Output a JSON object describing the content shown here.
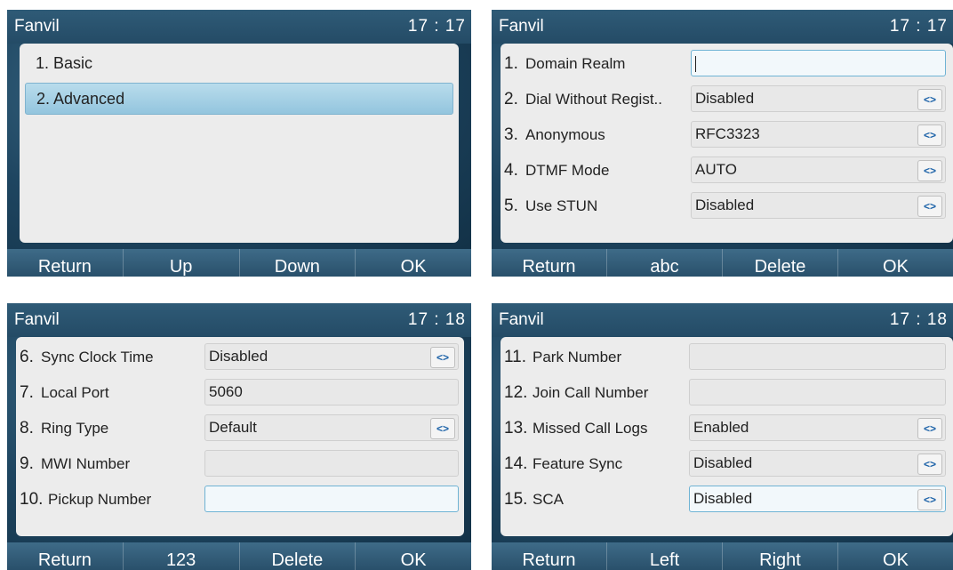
{
  "screens": [
    {
      "brand": "Fanvil",
      "time": "17 : 17",
      "menu": [
        "1. Basic",
        "2. Advanced"
      ],
      "selected_index": 1,
      "softkeys": [
        "Return",
        "Up",
        "Down",
        "OK"
      ]
    },
    {
      "brand": "Fanvil",
      "time": "17 : 17",
      "rows": [
        {
          "num": "1.",
          "label": "Domain Realm",
          "value": "",
          "selector": false,
          "focused": true
        },
        {
          "num": "2.",
          "label": "Dial Without Regist..",
          "value": "Disabled",
          "selector": true,
          "focused": false
        },
        {
          "num": "3.",
          "label": "Anonymous",
          "value": "RFC3323",
          "selector": true,
          "focused": false
        },
        {
          "num": "4.",
          "label": "DTMF Mode",
          "value": "AUTO",
          "selector": true,
          "focused": false
        },
        {
          "num": "5.",
          "label": "Use STUN",
          "value": "Disabled",
          "selector": true,
          "focused": false
        }
      ],
      "softkeys": [
        "Return",
        "abc",
        "Delete",
        "OK"
      ]
    },
    {
      "brand": "Fanvil",
      "time": "17 : 18",
      "rows": [
        {
          "num": "6.",
          "label": "Sync Clock Time",
          "value": "Disabled",
          "selector": true,
          "focused": false
        },
        {
          "num": "7.",
          "label": "Local Port",
          "value": "5060",
          "selector": false,
          "focused": false
        },
        {
          "num": "8.",
          "label": "Ring Type",
          "value": "Default",
          "selector": true,
          "focused": false
        },
        {
          "num": "9.",
          "label": "MWI Number",
          "value": "",
          "selector": false,
          "focused": false
        },
        {
          "num": "10.",
          "label": "Pickup Number",
          "value": "",
          "selector": false,
          "focused": true
        }
      ],
      "softkeys": [
        "Return",
        "123",
        "Delete",
        "OK"
      ]
    },
    {
      "brand": "Fanvil",
      "time": "17 : 18",
      "rows": [
        {
          "num": "11.",
          "label": "Park Number",
          "value": "",
          "selector": false,
          "focused": false
        },
        {
          "num": "12.",
          "label": "Join Call Number",
          "value": "",
          "selector": false,
          "focused": false
        },
        {
          "num": "13.",
          "label": "Missed Call Logs",
          "value": "Enabled",
          "selector": true,
          "focused": false
        },
        {
          "num": "14.",
          "label": "Feature Sync",
          "value": "Disabled",
          "selector": true,
          "focused": false
        },
        {
          "num": "15.",
          "label": "SCA",
          "value": "Disabled",
          "selector": true,
          "focused": true
        }
      ],
      "softkeys": [
        "Return",
        "Left",
        "Right",
        "OK"
      ]
    }
  ],
  "selector_glyph": "<>",
  "icons": {
    "selector": "left-right-arrows-icon",
    "cursor": "text-cursor-icon"
  }
}
